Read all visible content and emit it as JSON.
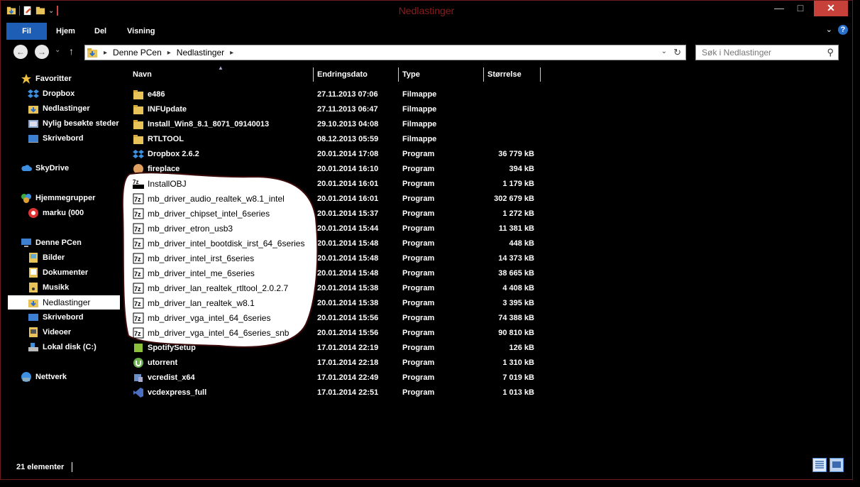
{
  "window": {
    "title": "Nedlastinger",
    "minimize": "—",
    "maximize": "□",
    "close": "✕"
  },
  "ribbon": {
    "tabs": [
      "Fil",
      "Hjem",
      "Del",
      "Visning"
    ],
    "help": "?"
  },
  "nav": {
    "back": "←",
    "forward": "→",
    "dropdown": "⌄",
    "up": "↑",
    "breadcrumbs": [
      "Denne PCen",
      "Nedlastinger"
    ],
    "search_placeholder": "Søk i Nedlastinger"
  },
  "sidebar": {
    "items": [
      {
        "label": "Favoritter",
        "icon": "star-icon"
      },
      {
        "label": "Dropbox",
        "icon": "dropbox-icon"
      },
      {
        "label": "Nedlastinger",
        "icon": "downloads-folder-icon"
      },
      {
        "label": "Nylig besøkte steder",
        "icon": "recent-places-icon"
      },
      {
        "label": "Skrivebord",
        "icon": "desktop-icon"
      },
      {
        "label": "SkyDrive",
        "icon": "cloud-icon"
      },
      {
        "label": "Hjemmegrupper",
        "icon": "homegroup-icon"
      },
      {
        "label": "marku (000",
        "icon": "user-icon"
      },
      {
        "label": "Denne PCen",
        "icon": "computer-icon"
      },
      {
        "label": "Bilder",
        "icon": "pictures-folder-icon"
      },
      {
        "label": "Dokumenter",
        "icon": "documents-folder-icon"
      },
      {
        "label": "Musikk",
        "icon": "music-folder-icon"
      },
      {
        "label": "Nedlastinger",
        "icon": "downloads-folder-icon"
      },
      {
        "label": "Skrivebord",
        "icon": "desktop-icon"
      },
      {
        "label": "Videoer",
        "icon": "videos-folder-icon"
      },
      {
        "label": "Lokal disk (C:)",
        "icon": "disk-icon"
      },
      {
        "label": "Nettverk",
        "icon": "network-icon"
      }
    ]
  },
  "columns": {
    "name": "Navn",
    "date": "Endringsdato",
    "type": "Type",
    "size": "Størrelse"
  },
  "files": [
    {
      "name": "e486",
      "date": "27.11.2013 07:06",
      "type": "Filmappe",
      "size": "",
      "icon": "folder-icon"
    },
    {
      "name": "INFUpdate",
      "date": "27.11.2013 06:47",
      "type": "Filmappe",
      "size": "",
      "icon": "folder-icon"
    },
    {
      "name": "Install_Win8_8.1_8071_09140013",
      "date": "29.10.2013 04:08",
      "type": "Filmappe",
      "size": "",
      "icon": "folder-icon"
    },
    {
      "name": "RTLTOOL",
      "date": "08.12.2013 05:59",
      "type": "Filmappe",
      "size": "",
      "icon": "folder-icon"
    },
    {
      "name": "Dropbox 2.6.2",
      "date": "20.01.2014 17:08",
      "type": "Program",
      "size": "36 779 kB",
      "icon": "dropbox-icon"
    },
    {
      "name": "fireplace",
      "date": "20.01.2014 16:10",
      "type": "Program",
      "size": "394 kB",
      "icon": "app-icon"
    },
    {
      "name": "InstallOBJ",
      "date": "20.01.2014 16:01",
      "type": "Program",
      "size": "1 179 kB",
      "icon": "sfx-icon"
    },
    {
      "name": "mb_driver_audio_realtek_w8.1_intel",
      "date": "20.01.2014 16:01",
      "type": "Program",
      "size": "302 679 kB",
      "icon": "7z-icon"
    },
    {
      "name": "mb_driver_chipset_intel_6series",
      "date": "20.01.2014 15:37",
      "type": "Program",
      "size": "1 272 kB",
      "icon": "7z-icon"
    },
    {
      "name": "mb_driver_etron_usb3",
      "date": "20.01.2014 15:44",
      "type": "Program",
      "size": "11 381 kB",
      "icon": "7z-icon"
    },
    {
      "name": "mb_driver_intel_bootdisk_irst_64_6series",
      "date": "20.01.2014 15:48",
      "type": "Program",
      "size": "448 kB",
      "icon": "7z-icon"
    },
    {
      "name": "mb_driver_intel_irst_6series",
      "date": "20.01.2014 15:48",
      "type": "Program",
      "size": "14 373 kB",
      "icon": "7z-icon"
    },
    {
      "name": "mb_driver_intel_me_6series",
      "date": "20.01.2014 15:48",
      "type": "Program",
      "size": "38 665 kB",
      "icon": "7z-icon"
    },
    {
      "name": "mb_driver_lan_realtek_rtltool_2.0.2.7",
      "date": "20.01.2014 15:38",
      "type": "Program",
      "size": "4 408 kB",
      "icon": "7z-icon"
    },
    {
      "name": "mb_driver_lan_realtek_w8.1",
      "date": "20.01.2014 15:38",
      "type": "Program",
      "size": "3 395 kB",
      "icon": "7z-icon"
    },
    {
      "name": "mb_driver_vga_intel_64_6series",
      "date": "20.01.2014 15:56",
      "type": "Program",
      "size": "74 388 kB",
      "icon": "7z-icon"
    },
    {
      "name": "mb_driver_vga_intel_64_6series_snb",
      "date": "20.01.2014 15:56",
      "type": "Program",
      "size": "90 810 kB",
      "icon": "7z-icon"
    },
    {
      "name": "SpotifySetup",
      "date": "17.01.2014 22:19",
      "type": "Program",
      "size": "126 kB",
      "icon": "spotify-icon"
    },
    {
      "name": "utorrent",
      "date": "17.01.2014 22:18",
      "type": "Program",
      "size": "1 310 kB",
      "icon": "utorrent-icon"
    },
    {
      "name": "vcredist_x64",
      "date": "17.01.2014 22:49",
      "type": "Program",
      "size": "7 019 kB",
      "icon": "installer-icon"
    },
    {
      "name": "vcdexpress_full",
      "date": "17.01.2014 22:51",
      "type": "Program",
      "size": "1 013 kB",
      "icon": "visualstudio-icon"
    }
  ],
  "status": {
    "count": "21 elementer"
  },
  "colors": {
    "accent": "#1e5fb5",
    "close": "#c7413a",
    "title": "#8b1c1c",
    "background": "#000000"
  }
}
